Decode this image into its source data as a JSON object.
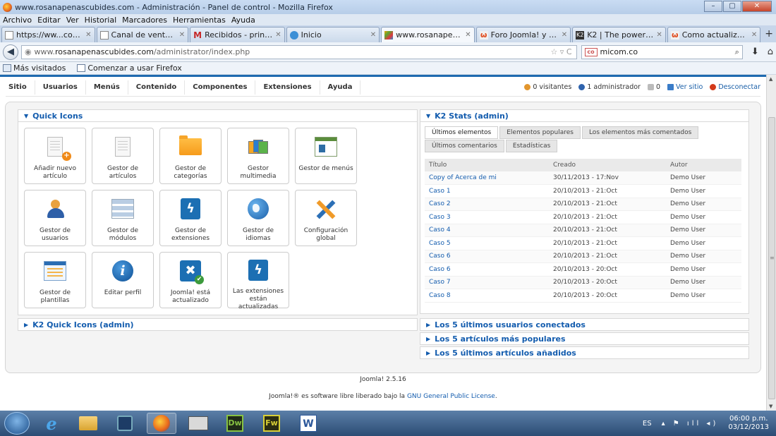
{
  "window": {
    "title": "www.rosanapenascubides.com - Administración - Panel de control - Mozilla Firefox"
  },
  "browser_menu": [
    "Archivo",
    "Editar",
    "Ver",
    "Historial",
    "Marcadores",
    "Herramientas",
    "Ayuda"
  ],
  "tabs": [
    {
      "label": "https://ww...co/ventas/",
      "icon": "page-icon"
    },
    {
      "label": "Canal de ventas - Mo...",
      "icon": "page-icon"
    },
    {
      "label": "Recibidos - printopub...",
      "icon": "gmail-icon"
    },
    {
      "label": "Inicio",
      "icon": "info-icon"
    },
    {
      "label": "www.rosanapenascu...",
      "icon": "joomla-icon",
      "active": true
    },
    {
      "label": "Foro Joomla! y Word...",
      "icon": "w-icon"
    },
    {
      "label": "K2 | The powerful con...",
      "icon": "k2-icon"
    },
    {
      "label": "Como actualizar los a...",
      "icon": "w-icon"
    }
  ],
  "address": {
    "prefix": "www.",
    "domain": "rosanapenascubides.com",
    "path": "/administrator/index.php"
  },
  "search": {
    "engine": "micom.co",
    "value": "micom.co"
  },
  "bookmarks": [
    "Más visitados",
    "Comenzar a usar Firefox"
  ],
  "admin_menu": [
    "Sitio",
    "Usuarios",
    "Menús",
    "Contenido",
    "Componentes",
    "Extensiones",
    "Ayuda"
  ],
  "status": {
    "visitors": "0 visitantes",
    "admins": "1 administrador",
    "messages": "0",
    "view_site": "Ver sitio",
    "logout": "Desconectar"
  },
  "quick_icons": {
    "title": "Quick Icons",
    "items": [
      {
        "label": "Añadir nuevo artículo",
        "icon": "add-article-icon"
      },
      {
        "label": "Gestor de artículos",
        "icon": "article-manager-icon"
      },
      {
        "label": "Gestor de categorías",
        "icon": "folder-icon"
      },
      {
        "label": "Gestor multimedia",
        "icon": "media-icon"
      },
      {
        "label": "Gestor de menús",
        "icon": "menu-manager-icon"
      },
      {
        "label": "Gestor de usuarios",
        "icon": "users-icon"
      },
      {
        "label": "Gestor de módulos",
        "icon": "modules-icon"
      },
      {
        "label": "Gestor de extensiones",
        "icon": "extensions-icon"
      },
      {
        "label": "Gestor de idiomas",
        "icon": "globe-icon"
      },
      {
        "label": "Configuración global",
        "icon": "tools-icon"
      },
      {
        "label": "Gestor de plantillas",
        "icon": "template-icon"
      },
      {
        "label": "Editar perfil",
        "icon": "info-icon"
      },
      {
        "label": "Joomla! está actualizado",
        "icon": "joomla-update-icon"
      },
      {
        "label": "Las extensiones están actualizadas",
        "icon": "extensions-update-icon"
      }
    ]
  },
  "k2_quick_icons": {
    "title": "K2 Quick Icons (admin)"
  },
  "k2_stats": {
    "title": "K2 Stats (admin)",
    "tabs": [
      "Últimos elementos",
      "Elementos populares",
      "Los elementos más comentados",
      "Últimos comentarios",
      "Estadísticas"
    ],
    "columns": [
      "Título",
      "Creado",
      "Autor"
    ],
    "rows": [
      [
        "Copy of Acerca de mi",
        "30/11/2013 - 17:Nov",
        "Demo User"
      ],
      [
        "Caso 1",
        "20/10/2013 - 21:Oct",
        "Demo User"
      ],
      [
        "Caso 2",
        "20/10/2013 - 21:Oct",
        "Demo User"
      ],
      [
        "Caso 3",
        "20/10/2013 - 21:Oct",
        "Demo User"
      ],
      [
        "Caso 4",
        "20/10/2013 - 21:Oct",
        "Demo User"
      ],
      [
        "Caso 5",
        "20/10/2013 - 21:Oct",
        "Demo User"
      ],
      [
        "Caso 6",
        "20/10/2013 - 21:Oct",
        "Demo User"
      ],
      [
        "Caso 6",
        "20/10/2013 - 20:Oct",
        "Demo User"
      ],
      [
        "Caso 7",
        "20/10/2013 - 20:Oct",
        "Demo User"
      ],
      [
        "Caso 8",
        "20/10/2013 - 20:Oct",
        "Demo User"
      ]
    ]
  },
  "accordions": [
    "Los 5 últimos usuarios conectados",
    "Los 5 artículos más populares",
    "Los 5 últimos artículos añadidos"
  ],
  "footer": {
    "version": "Joomla! 2.5.16",
    "license_pre": "Joomla!® es software libre liberado bajo la",
    "license_link": "GNU General Public License",
    "license_post": "."
  },
  "taskbar": {
    "lang": "ES",
    "time": "06:00 p.m.",
    "date": "03/12/2013",
    "apps": [
      "ie",
      "explorer",
      "media-player",
      "firefox",
      "computer",
      "Dw",
      "Fw",
      "W"
    ]
  },
  "colors": {
    "accent": "#135cae",
    "menu_border": "#1e6aaf"
  }
}
